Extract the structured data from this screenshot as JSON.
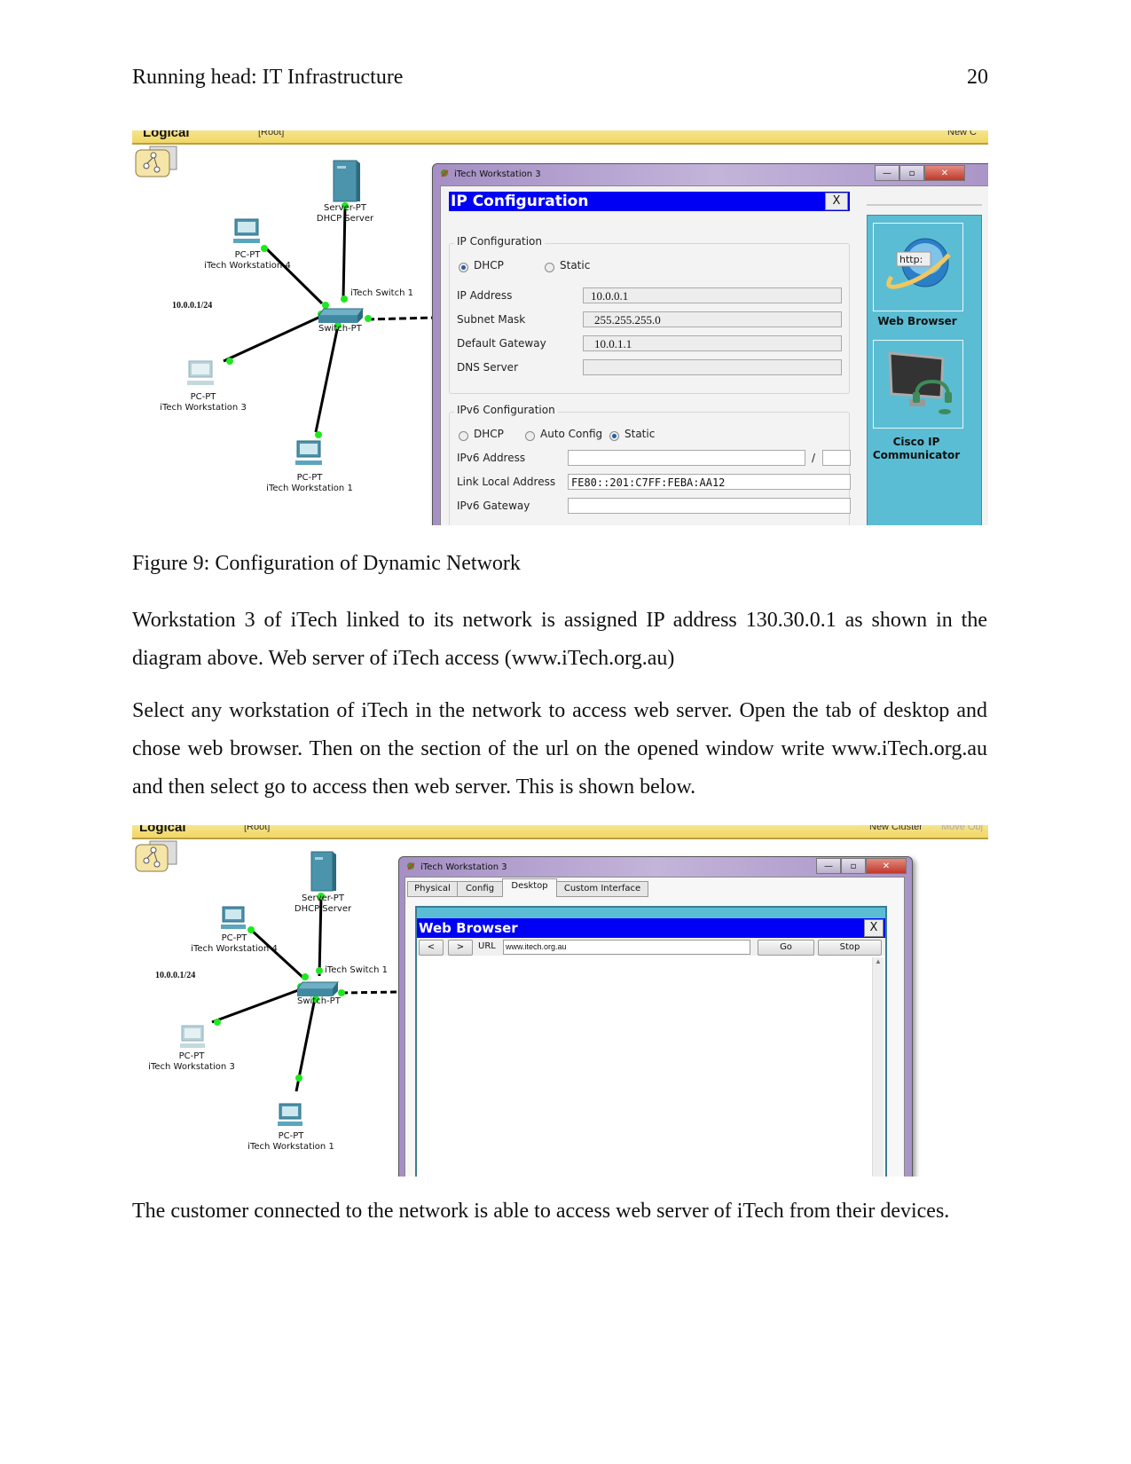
{
  "header": {
    "running_head": "Running head: IT Infrastructure",
    "page_number": "20"
  },
  "figure1": {
    "toolbar": {
      "logical": "Logical",
      "root": "[Root]",
      "new_cluster": "New C"
    },
    "diagram": {
      "server_type": "Server-PT",
      "server_name": "DHCP Server",
      "ws4_type": "PC-PT",
      "ws4_name": "iTech Workstation 4",
      "switch_name": "iTech Switch 1",
      "switch_type": "Switch-PT",
      "ws3_type": "PC-PT",
      "ws3_name": "iTech Workstation 3",
      "ws1_type": "PC-PT",
      "ws1_name": "iTech Workstation 1",
      "network_label": "10.0.0.1/24"
    },
    "window": {
      "title": "iTech Workstation 3",
      "panel_title": "IP Configuration",
      "close_label": "X",
      "ipv4": {
        "group_title": "IP Configuration",
        "mode_dhcp": "DHCP",
        "mode_static": "Static",
        "selected_mode": "DHCP",
        "fields": [
          {
            "label": "IP Address",
            "value": "10.0.0.1"
          },
          {
            "label": "Subnet Mask",
            "value": "255.255.255.0"
          },
          {
            "label": "Default Gateway",
            "value": "10.0.1.1"
          },
          {
            "label": "DNS Server",
            "value": ""
          }
        ]
      },
      "ipv6": {
        "group_title": "IPv6 Configuration",
        "mode_dhcp": "DHCP",
        "mode_auto": "Auto Config",
        "mode_static": "Static",
        "selected_mode": "Static",
        "address_label": "IPv6 Address",
        "address_value": "",
        "prefix_sep": "/",
        "link_local_label": "Link Local Address",
        "link_local_value": "FE80::201:C7FF:FEBA:AA12",
        "gateway_label": "IPv6 Gateway",
        "gateway_value": ""
      },
      "apps": [
        {
          "label": "Web Browser",
          "icon": "http-globe-icon",
          "icon_text": "http:"
        },
        {
          "label": "Cisco IP Communicator",
          "icon": "ip-phone-monitor-icon"
        }
      ]
    }
  },
  "caption1": "Figure 9: Configuration of Dynamic Network",
  "paragraphs": [
    "Workstation 3 of iTech linked to its network is assigned IP address 130.30.0.1 as shown in the diagram above. Web server of iTech access (www.iTech.org.au)",
    "Select any workstation of iTech in the network to access web server. Open the tab of desktop and chose web browser. Then on the section of the url on the opened window write www.iTech.org.au and then select go to access then web server. This is shown below."
  ],
  "figure2": {
    "toolbar": {
      "logical": "Logical",
      "root": "[Root]",
      "new_cluster": "New Cluster",
      "move_object": "Move Obj"
    },
    "diagram": {
      "server_type": "Server-PT",
      "server_name": "DHCP Server",
      "ws4_type": "PC-PT",
      "ws4_name": "iTech Workstation 4",
      "switch_name": "iTech Switch 1",
      "switch_type": "Switch-PT",
      "ws3_type": "PC-PT",
      "ws3_name": "iTech Workstation 3",
      "ws1_type": "PC-PT",
      "ws1_name": "iTech Workstation 1",
      "network_label": "10.0.0.1/24"
    },
    "window": {
      "title": "iTech Workstation 3",
      "tabs": [
        {
          "label": "Physical",
          "active": false
        },
        {
          "label": "Config",
          "active": false
        },
        {
          "label": "Desktop",
          "active": true
        },
        {
          "label": "Custom Interface",
          "active": false
        }
      ],
      "browser": {
        "title": "Web Browser",
        "close_label": "X",
        "back_label": "<",
        "forward_label": ">",
        "url_label": "URL",
        "url_value": "www.itech.org.au",
        "go_label": "Go",
        "stop_label": "Stop"
      }
    }
  },
  "closing_paragraph": "The customer connected to the network is able to access web server of iTech from their devices."
}
